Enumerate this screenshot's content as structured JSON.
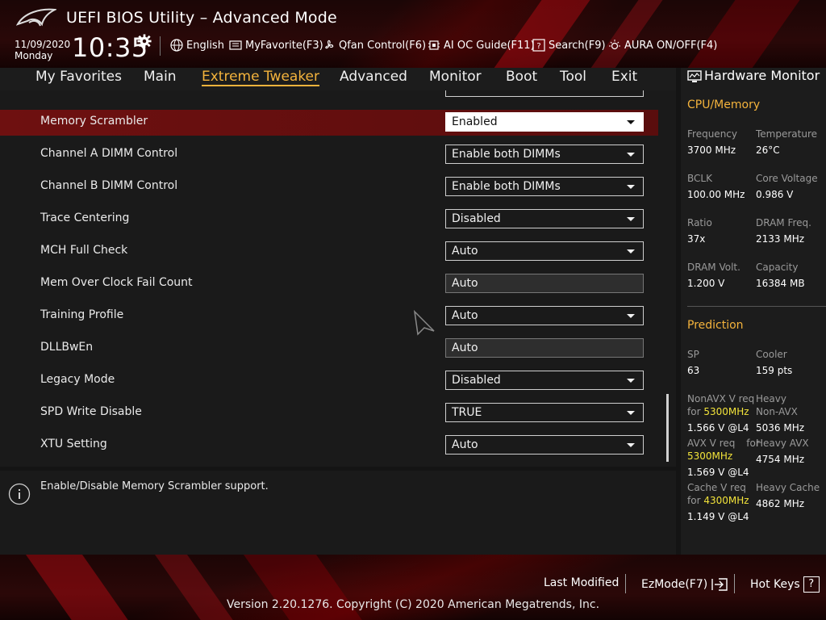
{
  "header": {
    "title": "UEFI BIOS Utility – Advanced Mode",
    "date": "11/09/2020",
    "day": "Monday",
    "time": "10:35",
    "toolbar": {
      "language": "English",
      "myfavorite": "MyFavorite(F3)",
      "qfan": "Qfan Control(F6)",
      "aioc": "AI OC Guide(F11)",
      "search": "Search(F9)",
      "aura": "AURA ON/OFF(F4)"
    }
  },
  "nav": {
    "tabs": [
      "My Favorites",
      "Main",
      "Extreme Tweaker",
      "Advanced",
      "Monitor",
      "Boot",
      "Tool",
      "Exit"
    ],
    "active": "Extreme Tweaker"
  },
  "settings": [
    {
      "label": "Memory Scrambler",
      "value": "Enabled",
      "selected": true,
      "dropdown": true
    },
    {
      "label": "Channel A DIMM Control",
      "value": "Enable both DIMMs",
      "dropdown": true
    },
    {
      "label": "Channel B DIMM Control",
      "value": "Enable both DIMMs",
      "dropdown": true
    },
    {
      "label": "Trace Centering",
      "value": "Disabled",
      "dropdown": true
    },
    {
      "label": "MCH Full Check",
      "value": "Auto",
      "dropdown": true
    },
    {
      "label": "Mem Over Clock Fail Count",
      "value": "Auto",
      "dropdown": false
    },
    {
      "label": "Training Profile",
      "value": "Auto",
      "dropdown": true
    },
    {
      "label": "DLLBwEn",
      "value": "Auto",
      "dropdown": false
    },
    {
      "label": "Legacy Mode",
      "value": "Disabled",
      "dropdown": true
    },
    {
      "label": "SPD Write Disable",
      "value": "TRUE",
      "dropdown": true
    },
    {
      "label": "XTU Setting",
      "value": "Auto",
      "dropdown": true
    }
  ],
  "help": {
    "text": "Enable/Disable Memory Scrambler support."
  },
  "hardware_monitor": {
    "title": "Hardware Monitor",
    "cpu_memory": {
      "heading": "CPU/Memory",
      "frequency_label": "Frequency",
      "frequency": "3700 MHz",
      "temperature_label": "Temperature",
      "temperature": "26°C",
      "bclk_label": "BCLK",
      "bclk": "100.00 MHz",
      "core_voltage_label": "Core Voltage",
      "core_voltage": "0.986 V",
      "ratio_label": "Ratio",
      "ratio": "37x",
      "dram_freq_label": "DRAM Freq.",
      "dram_freq": "2133 MHz",
      "dram_volt_label": "DRAM Volt.",
      "dram_volt": "1.200 V",
      "capacity_label": "Capacity",
      "capacity": "16384 MB"
    },
    "prediction": {
      "heading": "Prediction",
      "sp_label": "SP",
      "sp": "63",
      "cooler_label": "Cooler",
      "cooler": "159 pts",
      "nonavx_label_1": "NonAVX V req",
      "nonavx_for": "for",
      "nonavx_freq": "5300MHz",
      "nonavx_value": "1.566 V @L4",
      "heavy_nonavx_label_1": "Heavy",
      "heavy_nonavx_label_2": "Non-AVX",
      "heavy_nonavx_value": "5036 MHz",
      "avx_label_1": "AVX V req",
      "avx_for": "for",
      "avx_freq": "5300MHz",
      "avx_value": "1.569 V @L4",
      "heavy_avx_label": "Heavy AVX",
      "heavy_avx_value": "4754 MHz",
      "cache_label_1": "Cache V req",
      "cache_for": "for",
      "cache_freq": "4300MHz",
      "cache_value": "1.149 V @L4",
      "heavy_cache_label": "Heavy Cache",
      "heavy_cache_value": "4862 MHz"
    }
  },
  "footer": {
    "last_modified": "Last Modified",
    "ezmode": "EzMode(F7)",
    "hot_keys": "Hot Keys",
    "hot_keys_key": "?",
    "copyright": "Version 2.20.1276. Copyright (C) 2020 American Megatrends, Inc."
  },
  "colors": {
    "accent": "#f4b33c",
    "highlight": "#f2e33a",
    "selected_row": "#6e1010"
  }
}
